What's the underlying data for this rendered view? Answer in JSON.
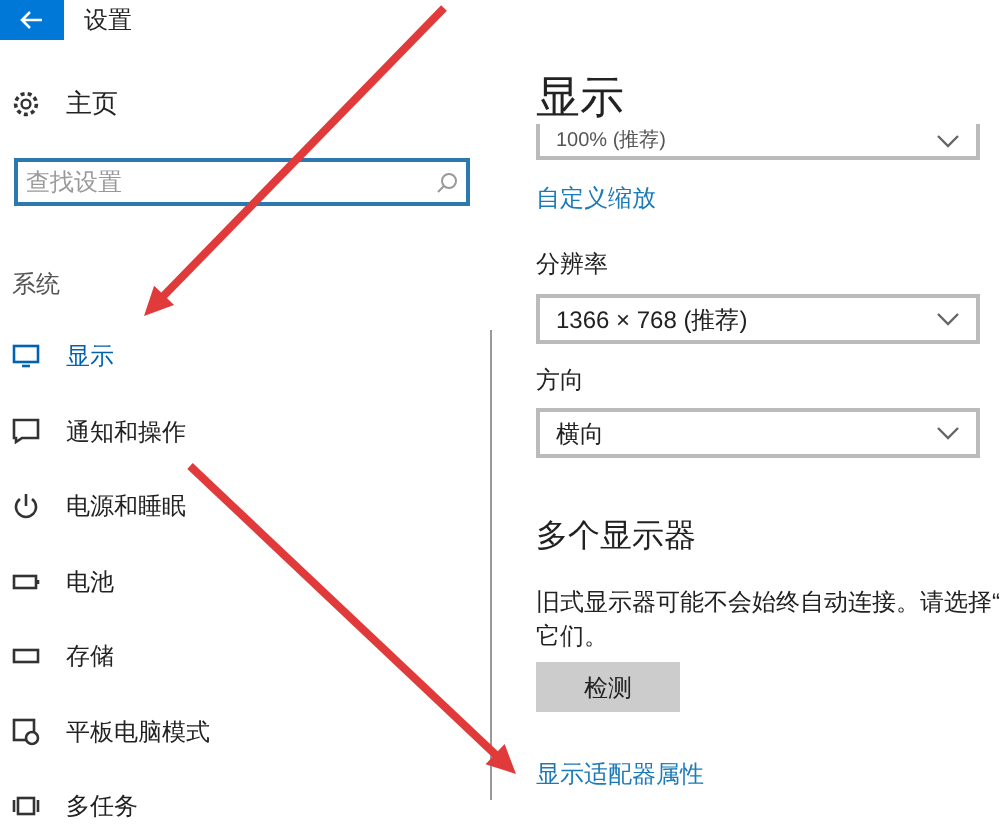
{
  "window": {
    "title": "设置"
  },
  "sidebar": {
    "home": "主页",
    "search": {
      "placeholder": "查找设置"
    },
    "section": "系统",
    "items": [
      {
        "label": "显示",
        "kind": "monitor",
        "selected": true
      },
      {
        "label": "通知和操作",
        "kind": "message",
        "selected": false
      },
      {
        "label": "电源和睡眠",
        "kind": "power",
        "selected": false
      },
      {
        "label": "电池",
        "kind": "battery",
        "selected": false
      },
      {
        "label": "存储",
        "kind": "storage",
        "selected": false
      },
      {
        "label": "平板电脑模式",
        "kind": "tablet",
        "selected": false
      },
      {
        "label": "多任务",
        "kind": "multitask",
        "selected": false
      }
    ]
  },
  "content": {
    "heading": "显示",
    "scale_value": "100% (推荐)",
    "custom_scale_link": "自定义缩放",
    "resolution": {
      "label": "分辨率",
      "value": "1366 × 768 (推荐)"
    },
    "orientation": {
      "label": "方向",
      "value": "横向"
    },
    "multi_display": {
      "heading": "多个显示器",
      "description_lines": [
        "旧式显示器可能不会始终自动连接。请选择“",
        "它们。"
      ],
      "button": "检测"
    },
    "adapter_link": "显示适配器属性"
  }
}
